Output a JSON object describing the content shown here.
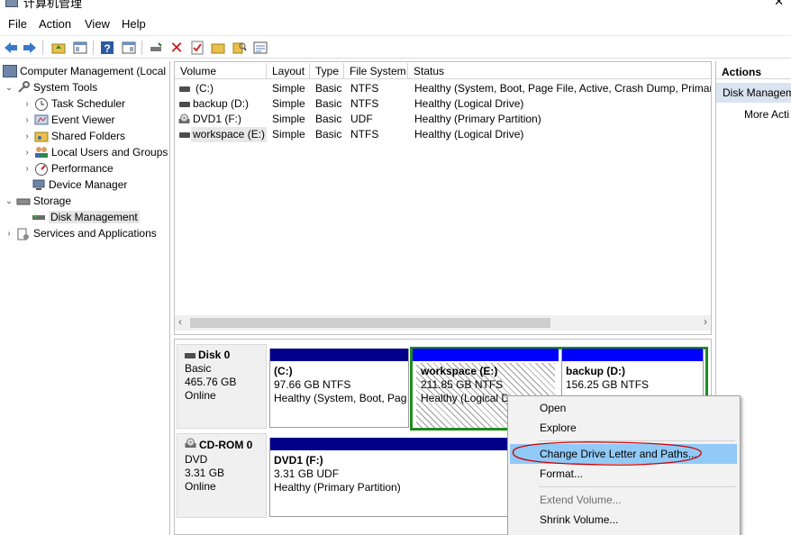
{
  "window": {
    "title": "计算机管理"
  },
  "menu": {
    "file": "File",
    "action": "Action",
    "view": "View",
    "help": "Help"
  },
  "tree": {
    "root": "Computer Management (Local",
    "system_tools": "System Tools",
    "task_scheduler": "Task Scheduler",
    "event_viewer": "Event Viewer",
    "shared_folders": "Shared Folders",
    "local_users": "Local Users and Groups",
    "performance": "Performance",
    "device_manager": "Device Manager",
    "storage": "Storage",
    "disk_management": "Disk Management",
    "services": "Services and Applications"
  },
  "volumes": {
    "headers": {
      "volume": "Volume",
      "layout": "Layout",
      "type": "Type",
      "fs": "File System",
      "status": "Status"
    },
    "rows": [
      {
        "volume": "(C:)",
        "layout": "Simple",
        "type": "Basic",
        "fs": "NTFS",
        "status": "Healthy (System, Boot, Page File, Active, Crash Dump, Primary"
      },
      {
        "volume": "backup (D:)",
        "layout": "Simple",
        "type": "Basic",
        "fs": "NTFS",
        "status": "Healthy (Logical Drive)"
      },
      {
        "volume": "DVD1 (F:)",
        "layout": "Simple",
        "type": "Basic",
        "fs": "UDF",
        "status": "Healthy (Primary Partition)"
      },
      {
        "volume": "workspace (E:)",
        "layout": "Simple",
        "type": "Basic",
        "fs": "NTFS",
        "status": "Healthy (Logical Drive)"
      }
    ]
  },
  "disks": {
    "disk0": {
      "name": "Disk 0",
      "type": "Basic",
      "size": "465.76 GB",
      "state": "Online"
    },
    "cdrom0": {
      "name": "CD-ROM 0",
      "type": "DVD",
      "size": "3.31 GB",
      "state": "Online"
    },
    "c": {
      "name": "(C:)",
      "size": "97.66 GB NTFS",
      "status": "Healthy (System, Boot, Pag"
    },
    "e": {
      "name": "workspace  (E:)",
      "size": "211.85 GB NTFS",
      "status": "Healthy (Logical D"
    },
    "d": {
      "name": "backup  (D:)",
      "size": "156.25 GB NTFS"
    },
    "f": {
      "name": "DVD1  (F:)",
      "size": "3.31 GB UDF",
      "status": "Healthy (Primary Partition)"
    }
  },
  "actions": {
    "header": "Actions",
    "section": "Disk Managem",
    "more": "More Acti"
  },
  "context_menu": {
    "open": "Open",
    "explore": "Explore",
    "change_letter": "Change Drive Letter and Paths...",
    "format": "Format...",
    "extend": "Extend Volume...",
    "shrink": "Shrink Volume..."
  },
  "colors": {
    "primary_partition": "#00008b",
    "logical_drive": "#0000ff",
    "extended_border": "#1e8c1e",
    "menu_highlight": "#91c9f7",
    "annotation": "#cc0000"
  }
}
